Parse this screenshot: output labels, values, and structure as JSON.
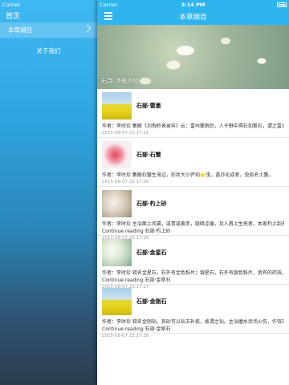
{
  "left_status": {
    "carrier": "Carrier"
  },
  "drawer": {
    "header": "首页",
    "items": [
      {
        "label": "本草纲目",
        "active": true
      },
      {
        "label": "关于我们",
        "active": false
      }
    ]
  },
  "main_status": {
    "carrier": "Carrier",
    "time": "3:14 PM"
  },
  "navbar": {
    "title": "本草纲目"
  },
  "hero": {
    "caption": "石部·汤瓶内硷"
  },
  "articles": [
    {
      "title": "石部·雷墨",
      "summary": "作者：李时珍 集解《刘恂岭表录异》云：雷州骤雨后，人于野中得石如黳石，谓之雷公",
      "more": "",
      "date": "2015-08-07 22:17:31",
      "thumb": "rape"
    },
    {
      "title": "石部·石蟹",
      "summary": "作者：李时珍 集解石蟹生海边，形状大小俨如🌟虫，盖亦化成者，虫俗名土蟹。",
      "more": "",
      "date": "2015-08-07 22:17:30",
      "thumb": "flower"
    },
    {
      "title": "石部·杓上砂",
      "summary": "作者：李时珍 主治面上风粟，或青或黄赤，隐暗涩痛，及人唇上生疮者，本家杓上刮去",
      "more": "Continue reading 石部·杓上砂",
      "date": "2015-08-07 22:17:28",
      "thumb": "white"
    },
    {
      "title": "石部·金星石",
      "summary": "作者：李时珍 释名金星石，石外有金色麸片；银星石，石外有银色麸片，皆有的药效。",
      "more": "Continue reading 石部·金星石",
      "date": "2015-08-07 22:17:27",
      "thumb": "daisy"
    },
    {
      "title": "石部·金刚石",
      "summary": "作者：李时珍 释名金刚钻。其砂可以钻玉补瓷，故谓之钻。主治磨水涂汤火伤，作钗环",
      "more": "Continue reading 石部·金刚石",
      "date": "2015-08-07 22:17:26",
      "thumb": "rape"
    }
  ]
}
